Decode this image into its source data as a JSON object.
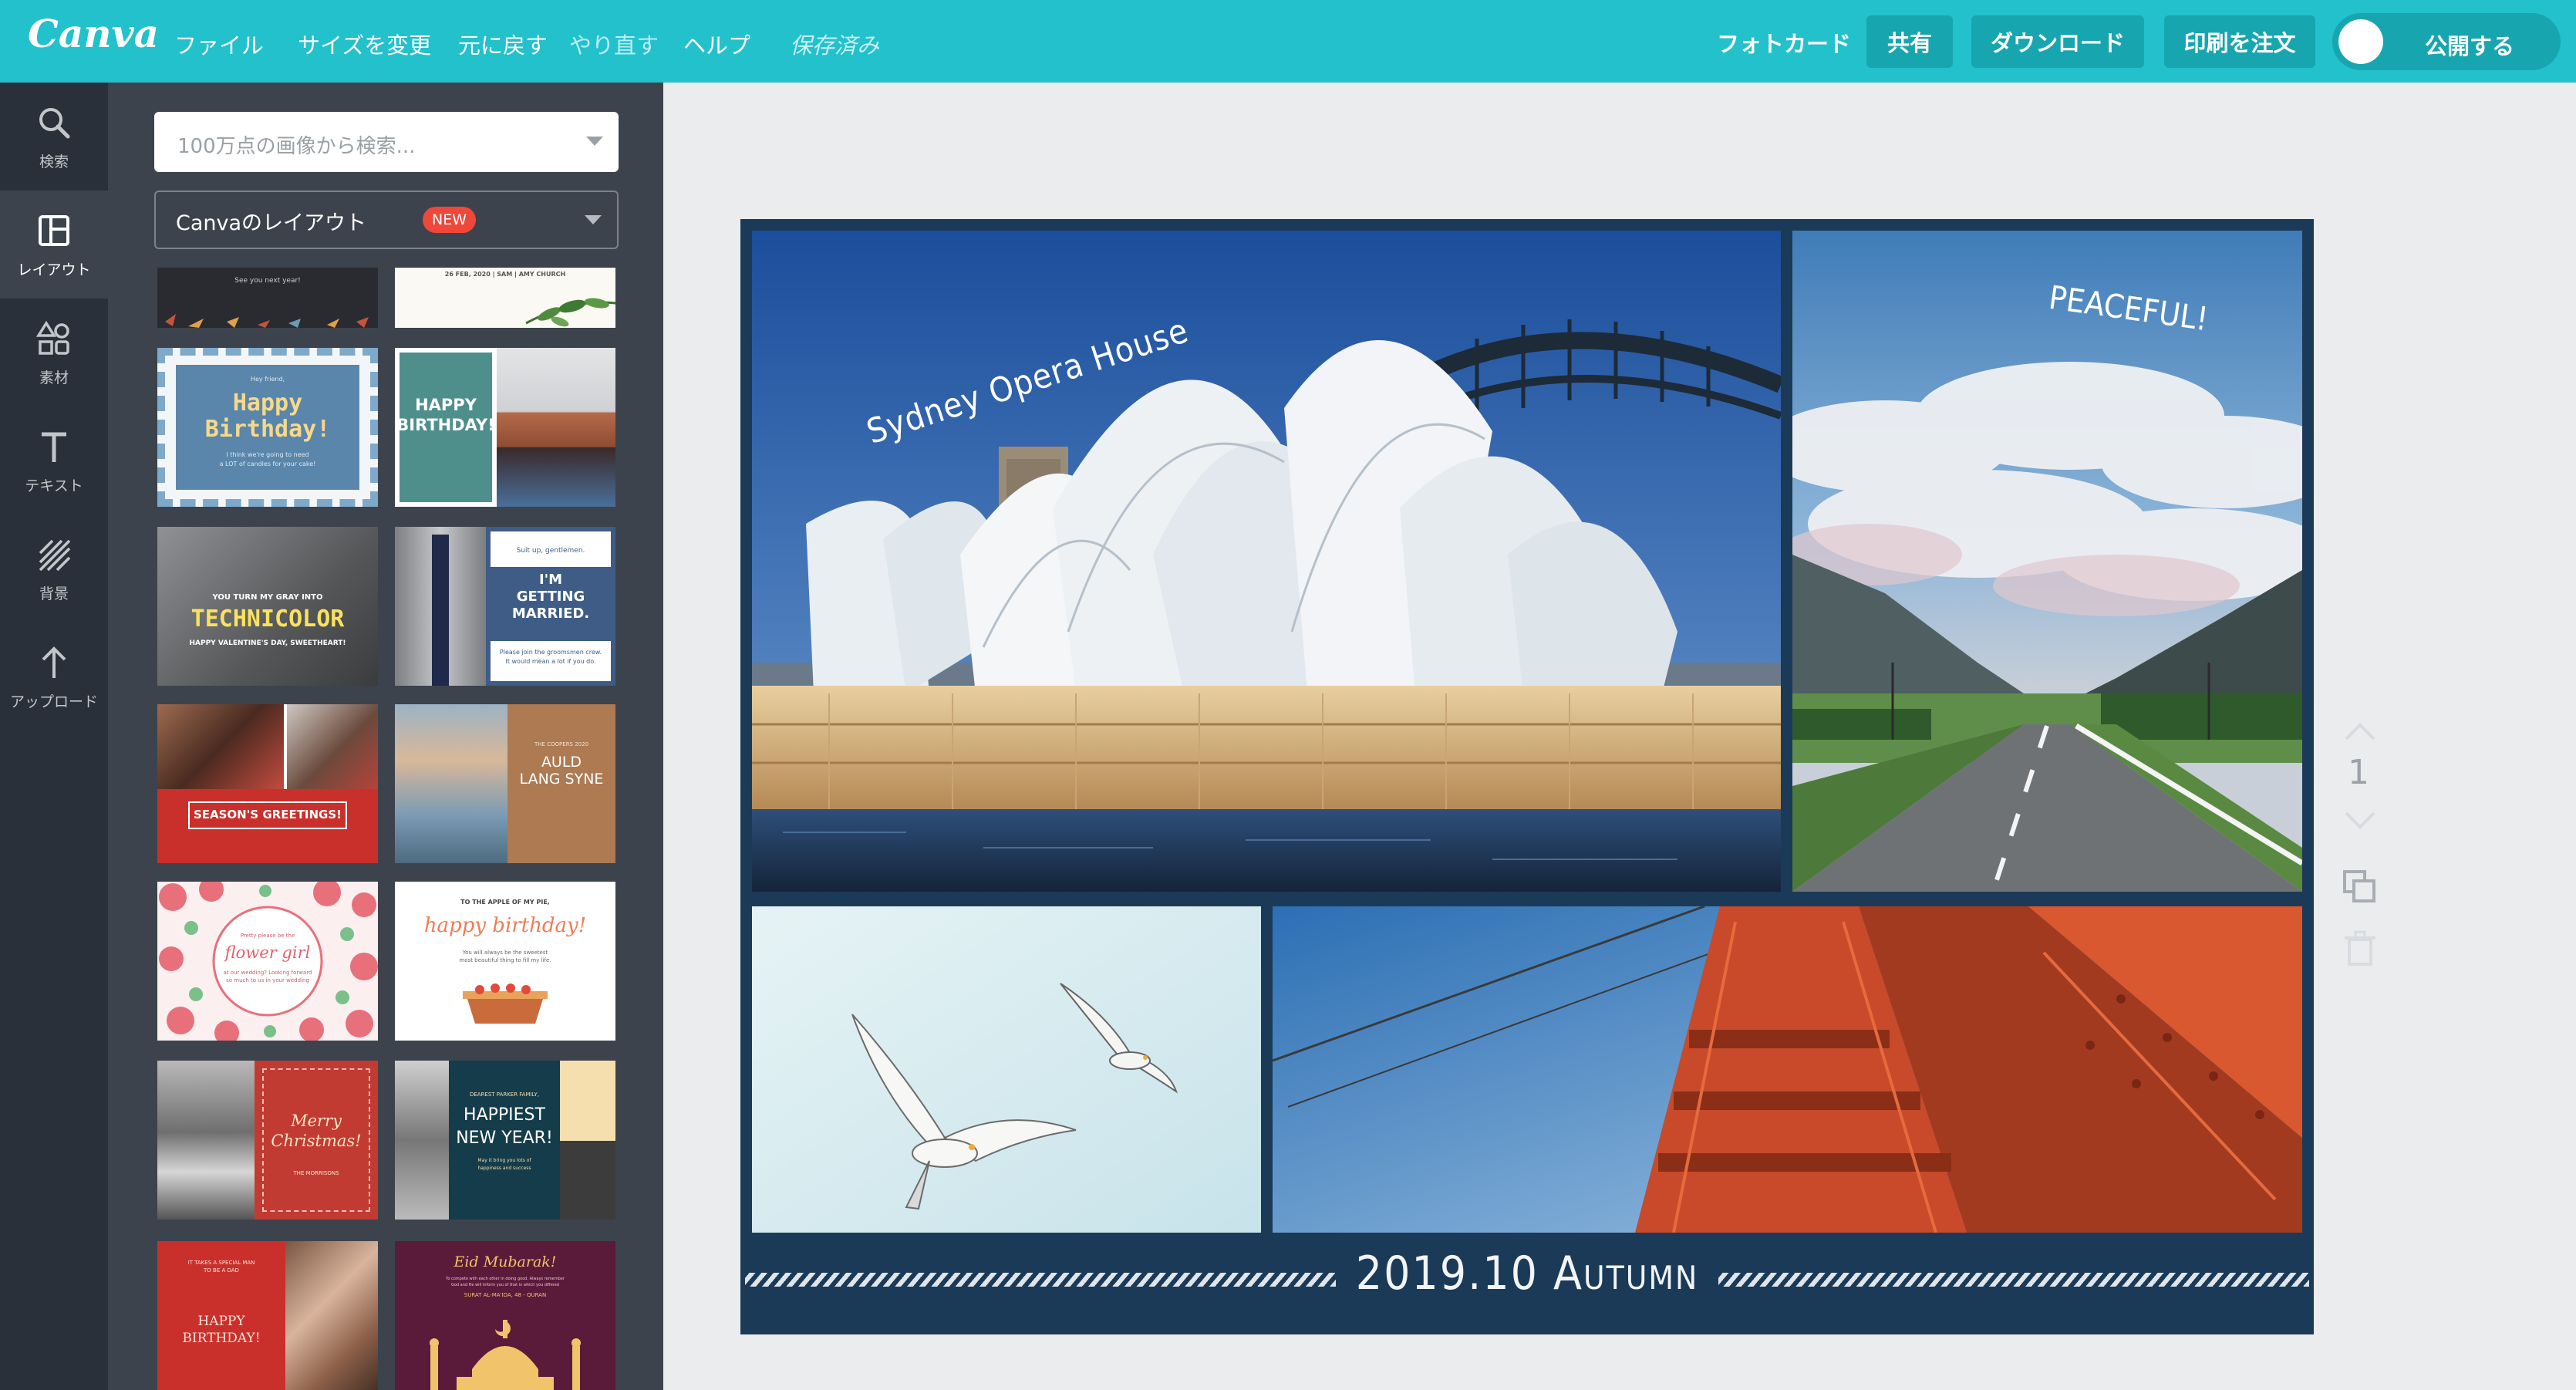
{
  "app": {
    "logo": "Canva",
    "menu": {
      "file": "ファイル",
      "resize": "サイズを変更",
      "undo": "元に戻す",
      "redo": "やり直す",
      "help": "ヘルプ",
      "saved": "保存済み"
    },
    "doc_type": "フォトカード",
    "buttons": {
      "share": "共有",
      "download": "ダウンロード",
      "print": "印刷を注文",
      "publish": "公開する"
    }
  },
  "sidebar": {
    "items": [
      {
        "label": "検索",
        "icon": "search-icon"
      },
      {
        "label": "レイアウト",
        "icon": "layout-icon"
      },
      {
        "label": "素材",
        "icon": "elements-icon"
      },
      {
        "label": "テキスト",
        "icon": "text-icon"
      },
      {
        "label": "背景",
        "icon": "background-icon"
      },
      {
        "label": "アップロード",
        "icon": "upload-icon"
      }
    ]
  },
  "panel": {
    "search_placeholder": "100万点の画像から検索...",
    "filter_label": "Canvaのレイアウト",
    "filter_badge": "NEW",
    "templates": [
      {
        "lines": [
          "See you next year!"
        ]
      },
      {
        "lines": [
          "26 FEB, 2020 | SAM | AMY CHURCH"
        ]
      },
      {
        "lines": [
          "Hey friend,",
          "Happy",
          "Birthday!",
          "I think we're going to need",
          "a LOT of candles for your cake!"
        ]
      },
      {
        "lines": [
          "HAPPY",
          "BIRTHDAY!"
        ]
      },
      {
        "lines": [
          "YOU TURN MY GRAY INTO",
          "TECHNICOLOR",
          "HAPPY VALENTINE'S DAY, SWEETHEART!"
        ]
      },
      {
        "lines": [
          "Suit up, gentlemen.",
          "I'M",
          "GETTING",
          "MARRIED.",
          "Please join the groomsmen crew.",
          "It would mean a lot if you do."
        ]
      },
      {
        "lines": [
          "SEASON'S GREETINGS!"
        ]
      },
      {
        "lines": [
          "THE COOPERS 2020",
          "AULD",
          "LANG SYNE"
        ]
      },
      {
        "lines": [
          "Pretty please be the",
          "flower girl",
          "at our wedding? Looking forward",
          "so much to us in your wedding"
        ]
      },
      {
        "lines": [
          "TO THE APPLE OF MY PIE,",
          "happy birthday!",
          "You will always be the sweetest",
          "most beautiful thing to fill my life."
        ]
      },
      {
        "lines": [
          "Merry",
          "Christmas!",
          "THE MORRISONS"
        ]
      },
      {
        "lines": [
          "DEAREST PARKER FAMILY,",
          "HAPPIEST",
          "NEW YEAR!",
          "May it bring you lots of",
          "happiness and success"
        ]
      },
      {
        "lines": [
          "IT TAKES A SPECIAL MAN",
          "TO BE A DAD",
          "HAPPY",
          "BIRTHDAY!"
        ]
      },
      {
        "lines": [
          "Eid Mubarak!",
          "To compete with each other in doing good. Always remember",
          "God and He will inform you of that in which you differed",
          "SURAT AL-MA'IDA, 48 - QURAN"
        ]
      }
    ]
  },
  "design": {
    "captions": {
      "opera": "Sydney Opera House",
      "peaceful": "PEACEFUL!",
      "footer": "2019.10 Autumn"
    },
    "colors": {
      "frame": "#1b3a57",
      "accent": "#22c1cc"
    }
  },
  "page_tools": {
    "page_number": "1"
  }
}
